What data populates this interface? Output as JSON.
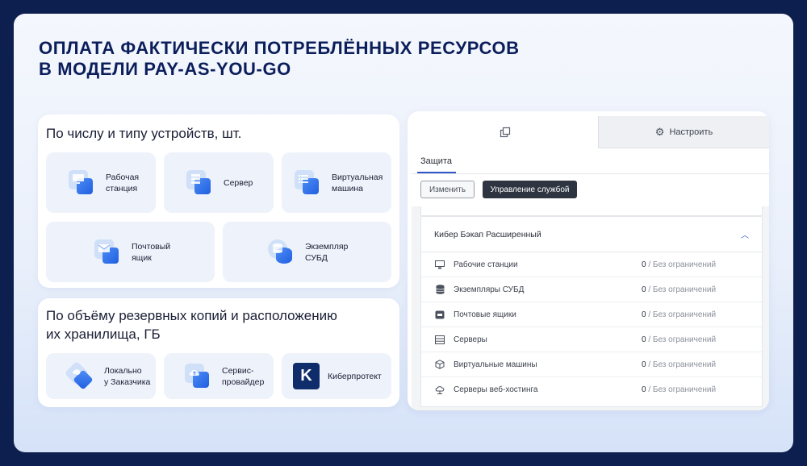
{
  "headline": {
    "line1": "Оплата фактически потреблённых ресурсов",
    "line2": "в модели Pay-as-you-go"
  },
  "devices_panel": {
    "title": "По числу и типу устройств, шт.",
    "tiles": [
      {
        "label": "Рабочая\nстанция",
        "icon": "workstation-icon"
      },
      {
        "label": "Сервер",
        "icon": "server-icon"
      },
      {
        "label": "Виртуальная\nмашина",
        "icon": "virtual-machine-icon"
      },
      {
        "label": "Почтовый\nящик",
        "icon": "mailbox-icon"
      },
      {
        "label": "Экземпляр\nСУБД",
        "icon": "database-icon"
      }
    ]
  },
  "storage_panel": {
    "title_line1": "По объёму резервных копий и расположению",
    "title_line2": "их хранилища, ГБ",
    "tiles": [
      {
        "label": "Локально\nу Заказчика",
        "icon": "local-storage-icon"
      },
      {
        "label": "Сервис-\nпровайдер",
        "icon": "cloud-provider-icon"
      },
      {
        "label": "Киберпротект",
        "icon": "cyberprotect-logo",
        "logo_letter": "K"
      }
    ]
  },
  "console": {
    "tabs": {
      "tab1_icon": "copy-icon",
      "tab2_label": "Настроить",
      "tab2_icon": "gear-icon"
    },
    "subtab": "Защита",
    "buttons": {
      "edit": "Изменить",
      "manage": "Управление службой"
    },
    "card_title": "Кибер Бэкап Расширенный",
    "rows": [
      {
        "label": "Рабочие станции",
        "value": "0",
        "limit": " / Без ограничений",
        "icon": "monitor-icon"
      },
      {
        "label": "Экземпляры СУБД",
        "value": "0",
        "limit": " / Без ограничений",
        "icon": "database-icon"
      },
      {
        "label": "Почтовые ящики",
        "value": "0",
        "limit": " / Без ограничений",
        "icon": "mailbox-icon"
      },
      {
        "label": "Серверы",
        "value": "0",
        "limit": " / Без ограничений",
        "icon": "server-icon"
      },
      {
        "label": "Виртуальные машины",
        "value": "0",
        "limit": " / Без ограничений",
        "icon": "cube-icon"
      },
      {
        "label": "Серверы веб-хостинга",
        "value": "0",
        "limit": " / Без ограничений",
        "icon": "web-hosting-icon"
      }
    ]
  },
  "colors": {
    "page_bg": "#0d1f4e",
    "headline": "#0b1e5b",
    "accent_blue": "#1f5fe0",
    "dark_button": "#2e3440",
    "tab_underline": "#2f55c9",
    "logo_bg": "#0f2c6b"
  }
}
